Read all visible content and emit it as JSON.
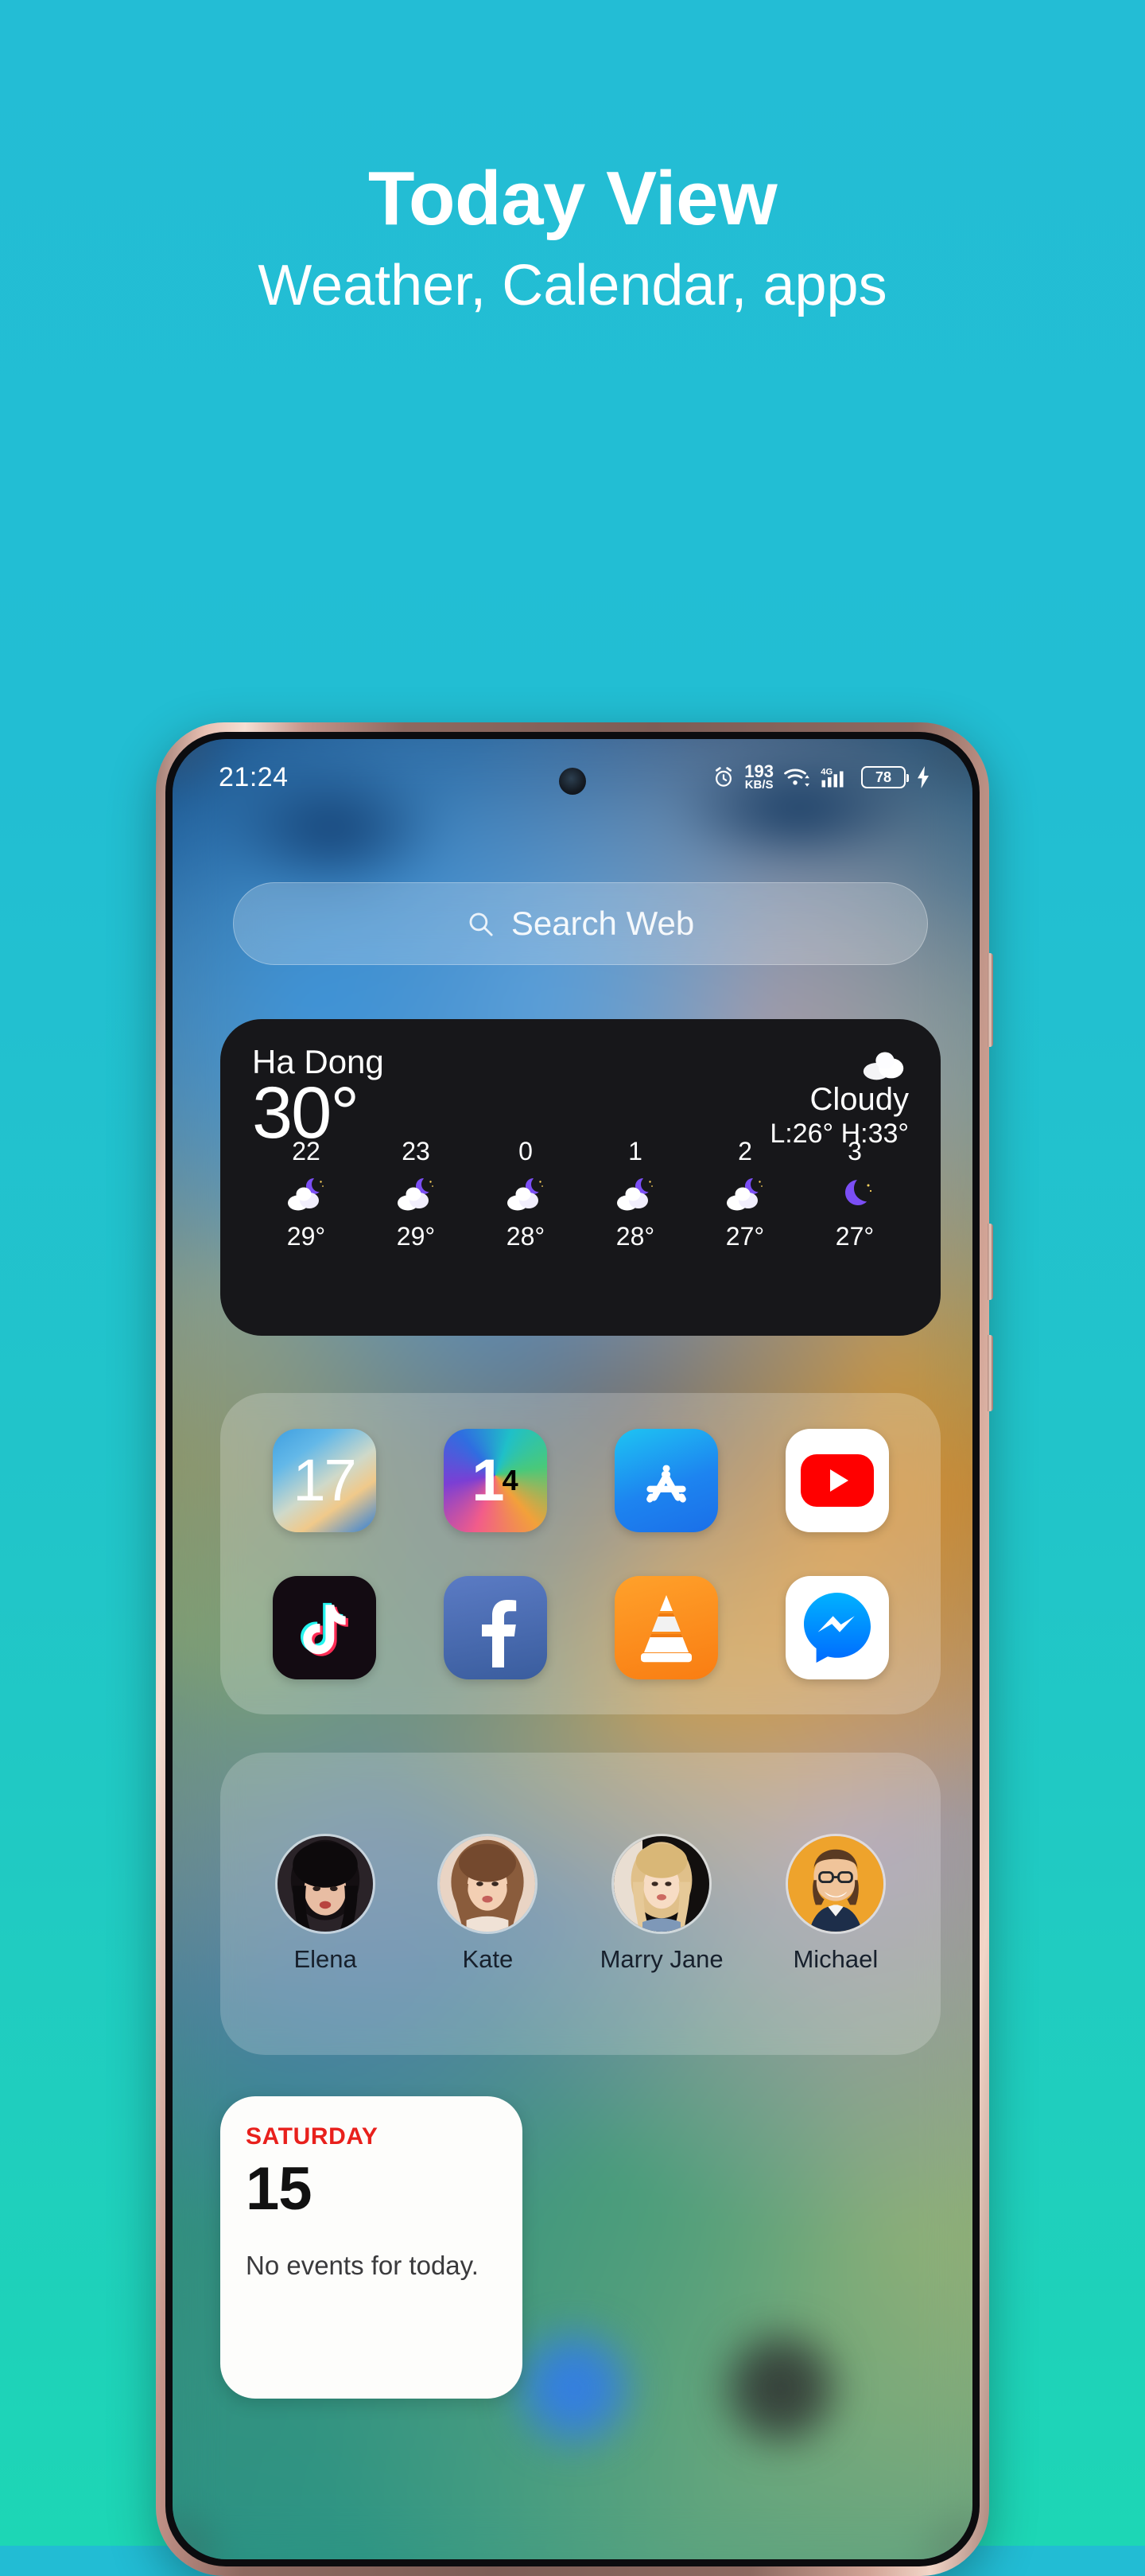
{
  "promo": {
    "title": "Today View",
    "subtitle": "Weather, Calendar, apps",
    "bg_color": "#22bcd4",
    "text_color": "#ffffff"
  },
  "phone": {
    "frame_color": "#8d6960",
    "side_buttons": [
      "power-button",
      "volume-up-button",
      "volume-down-button"
    ]
  },
  "status_bar": {
    "time": "21:24",
    "alarm_icon": "alarm-clock-icon",
    "net_speed_value": "193",
    "net_speed_unit": "KB/S",
    "wifi_icon": "wifi-icon",
    "network_type": "4G",
    "signal_icon": "signal-bars-icon",
    "battery_level": "78",
    "charging_icon": "lightning-bolt-icon"
  },
  "search": {
    "placeholder": "Search Web",
    "icon": "search-icon"
  },
  "weather": {
    "city": "Ha Dong",
    "temperature": "30°",
    "condition": "Cloudy",
    "high_low": "L:26° H:33°",
    "condition_icon": "cloud-icon",
    "hourly": [
      {
        "hour": "22",
        "icon": "cloudy-night-icon",
        "temp": "29°"
      },
      {
        "hour": "23",
        "icon": "cloudy-night-icon",
        "temp": "29°"
      },
      {
        "hour": "0",
        "icon": "cloudy-night-icon",
        "temp": "28°"
      },
      {
        "hour": "1",
        "icon": "cloudy-night-icon",
        "temp": "28°"
      },
      {
        "hour": "2",
        "icon": "cloudy-night-icon",
        "temp": "27°"
      },
      {
        "hour": "3",
        "icon": "crescent-moon-icon",
        "temp": "27°"
      }
    ]
  },
  "apps": [
    {
      "name": "ios17-launcher",
      "label": "17"
    },
    {
      "name": "ios14-launcher",
      "label": "1",
      "superscript": "4"
    },
    {
      "name": "app-store",
      "label": ""
    },
    {
      "name": "youtube",
      "label": ""
    },
    {
      "name": "tiktok",
      "label": ""
    },
    {
      "name": "facebook",
      "label": ""
    },
    {
      "name": "vlc-media-player",
      "label": ""
    },
    {
      "name": "messenger",
      "label": ""
    }
  ],
  "contacts": [
    {
      "name": "Elena"
    },
    {
      "name": "Kate"
    },
    {
      "name": "Marry Jane"
    },
    {
      "name": "Michael"
    }
  ],
  "calendar": {
    "weekday": "SATURDAY",
    "day": "15",
    "events_text": "No events for today.",
    "weekday_color": "#e8201c"
  }
}
